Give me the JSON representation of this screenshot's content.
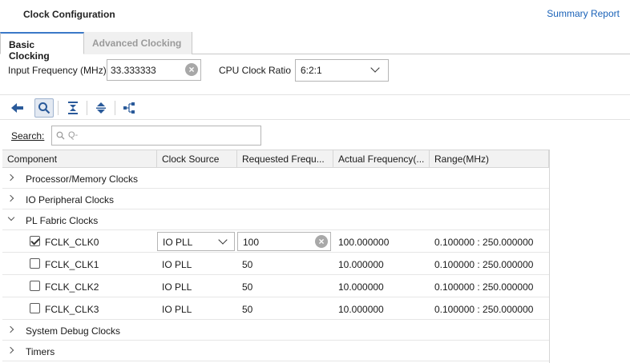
{
  "header": {
    "title": "Clock Configuration",
    "summary_link": "Summary Report"
  },
  "tabs": [
    {
      "label": "Basic Clocking",
      "active": true
    },
    {
      "label": "Advanced Clocking",
      "active": false
    }
  ],
  "params": {
    "input_frequency_label": "Input Frequency (MHz)",
    "input_frequency_value": "33.333333",
    "cpu_ratio_label": "CPU Clock Ratio",
    "cpu_ratio_value": "6:2:1"
  },
  "toolbar": {
    "buttons": [
      "back-icon",
      "search-icon",
      "collapse-all-icon",
      "expand-all-icon",
      "hierarchy-icon"
    ]
  },
  "search": {
    "label": "Search:",
    "placeholder": "Q-"
  },
  "table": {
    "headers": [
      "Component",
      "Clock Source",
      "Requested Frequ...",
      "Actual Frequency(...",
      "Range(MHz)"
    ],
    "rows": {
      "processor": "Processor/Memory Clocks",
      "io": "IO Peripheral Clocks",
      "pl": "PL Fabric Clocks",
      "fclk0": {
        "name": "FCLK_CLK0",
        "source": "IO PLL",
        "requested": "100",
        "actual": "100.000000",
        "range": "0.100000 : 250.000000",
        "checked": true
      },
      "fclk1": {
        "name": "FCLK_CLK1",
        "source": "IO PLL",
        "requested": "50",
        "actual": "10.000000",
        "range": "0.100000 : 250.000000",
        "checked": false
      },
      "fclk2": {
        "name": "FCLK_CLK2",
        "source": "IO PLL",
        "requested": "50",
        "actual": "10.000000",
        "range": "0.100000 : 250.000000",
        "checked": false
      },
      "fclk3": {
        "name": "FCLK_CLK3",
        "source": "IO PLL",
        "requested": "50",
        "actual": "10.000000",
        "range": "0.100000 : 250.000000",
        "checked": false
      },
      "debug": "System Debug Clocks",
      "timers": "Timers"
    }
  },
  "colors": {
    "accent": "#3a78c8",
    "link": "#1a62b8",
    "icon": "#2a5a9a"
  }
}
